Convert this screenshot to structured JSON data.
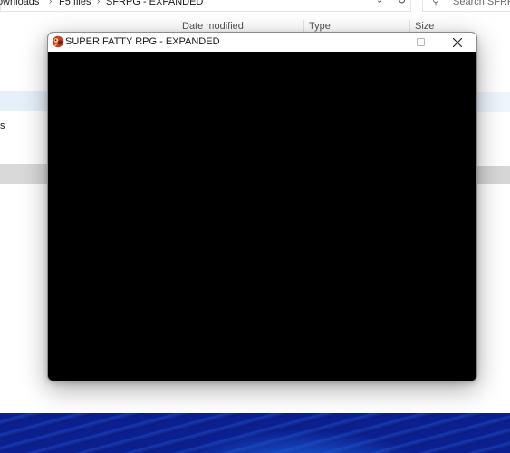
{
  "explorer": {
    "breadcrumb": [
      "Downloads",
      "F5 files",
      "SFRPG - EXPANDED"
    ],
    "search_placeholder": "Search SFRPG",
    "columns": {
      "date_modified": "Date modified",
      "type": "Type",
      "size": "Size"
    },
    "nav_fragment": "s",
    "icons": {
      "breadcrumb_separator": "chevron-right-icon",
      "refresh": "refresh-icon",
      "search": "search-icon"
    }
  },
  "game_window": {
    "title": "SUPER FATTY RPG - EXPANDED",
    "icon": "game-app-icon",
    "controls": {
      "minimize": "minimize-icon",
      "maximize": "maximize-icon",
      "close": "close-icon"
    }
  },
  "colors": {
    "titlebar": "#ffffff",
    "game_background": "#000000",
    "nav_selected": "#e6f0fb",
    "wallpaper": "#0b1f8f"
  }
}
